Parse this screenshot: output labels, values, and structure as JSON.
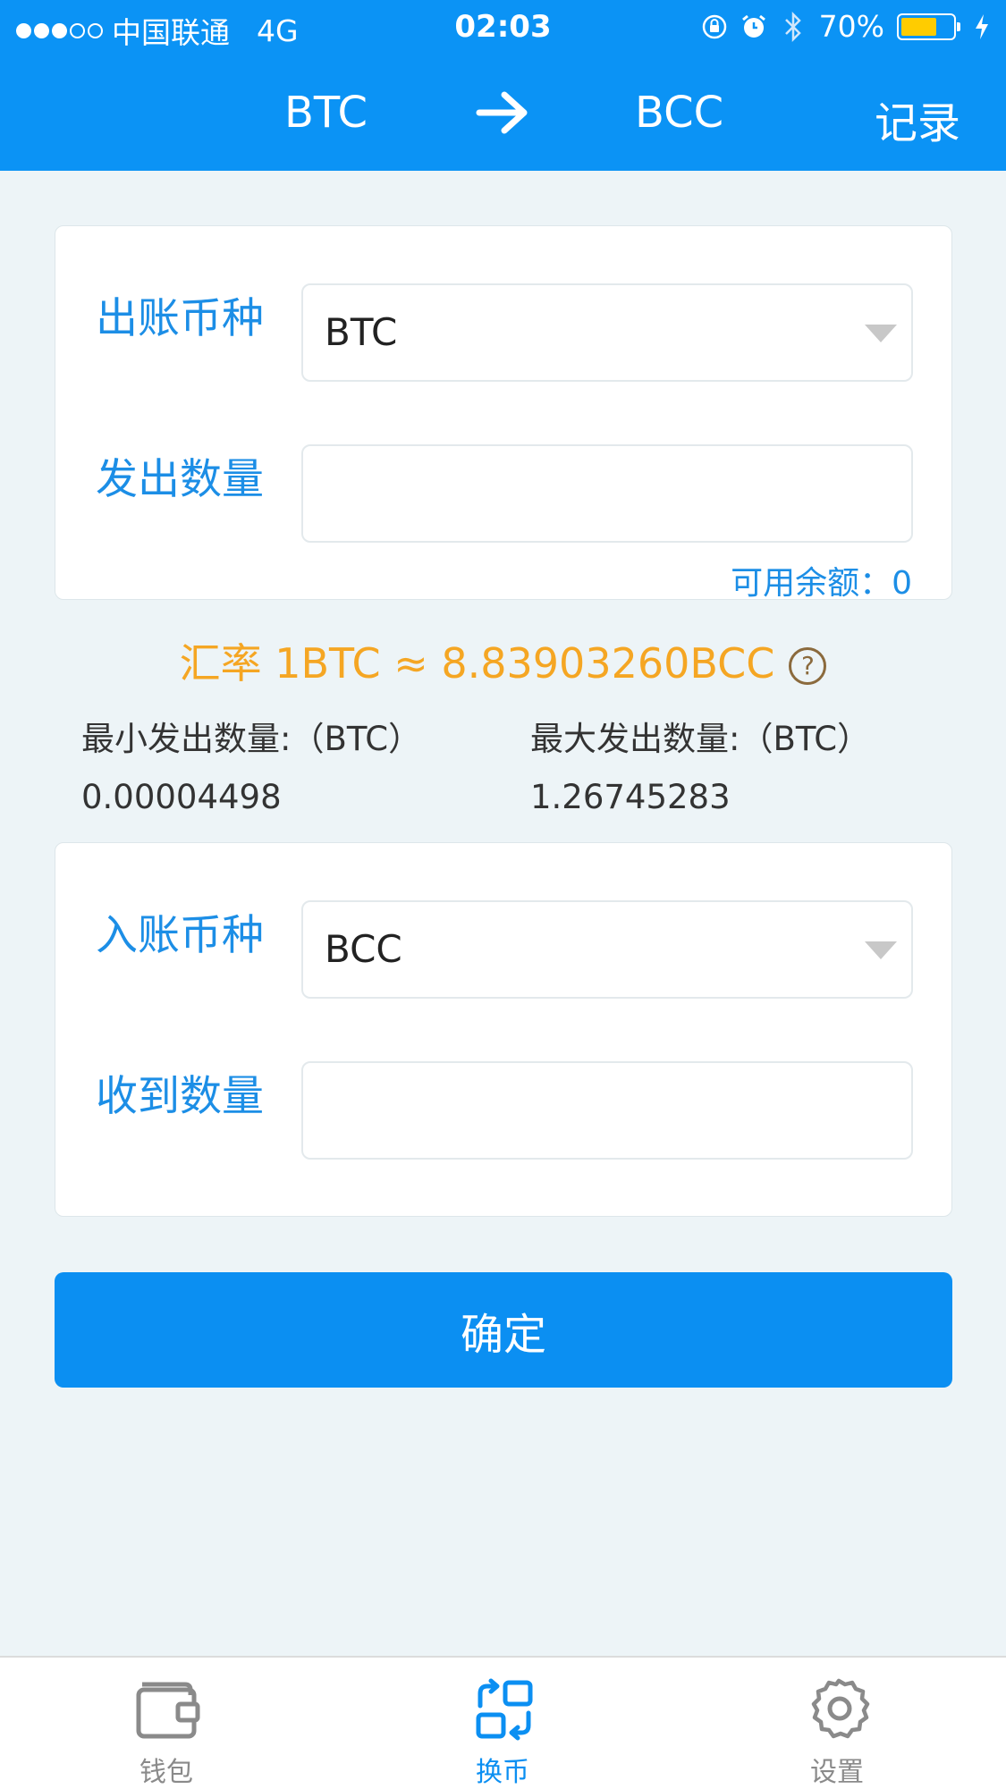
{
  "status_bar": {
    "carrier": "中国联通",
    "network": "4G",
    "time": "02:03",
    "battery": "70%",
    "battery_level": 0.7,
    "icons": [
      "signal-dots",
      "orientation-lock-icon",
      "alarm-icon",
      "bluetooth-icon",
      "battery-icon",
      "charging-icon"
    ]
  },
  "header": {
    "from_currency": "BTC",
    "to_currency": "BCC",
    "arrow_icon": "arrow-right-icon",
    "records_label": "记录"
  },
  "send_section": {
    "currency_label": "出账币种",
    "currency_value": "BTC",
    "amount_label": "发出数量",
    "amount_value": "",
    "balance_text": "可用余额：0"
  },
  "rate": {
    "text": "汇率 1BTC ≈ 8.83903260BCC",
    "help_icon": "?"
  },
  "limits": {
    "min_label": "最小发出数量:（BTC）",
    "min_value": "0.00004498",
    "max_label": "最大发出数量:（BTC）",
    "max_value": "1.26745283"
  },
  "receive_section": {
    "currency_label": "入账币种",
    "currency_value": "BCC",
    "amount_label": "收到数量",
    "amount_value": ""
  },
  "confirm_label": "确定",
  "tabs": [
    {
      "label": "钱包",
      "icon": "wallet-icon",
      "active": false
    },
    {
      "label": "换币",
      "icon": "exchange-icon",
      "active": true
    },
    {
      "label": "设置",
      "icon": "gear-icon",
      "active": false
    }
  ],
  "colors": {
    "primary": "#0b93f5",
    "label_blue": "#1c8ee6",
    "rate_orange": "#f5a623",
    "background": "#edf4f7",
    "battery_yellow": "#ffcc00"
  }
}
